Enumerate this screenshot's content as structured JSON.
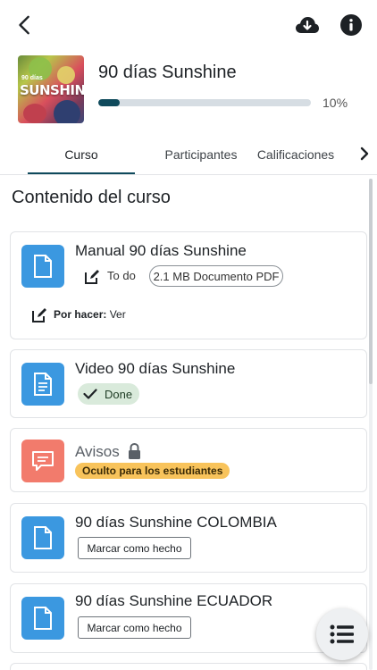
{
  "course": {
    "title": "90 días Sunshine",
    "progress_percent": 10,
    "progress_label": "10%",
    "thumbnail": {
      "line1": "90 días",
      "line2": "SUNSHINE"
    }
  },
  "topbar": {
    "back_icon": "arrow-left-icon",
    "download_icon": "cloud-download-icon",
    "info_icon": "info-icon"
  },
  "tabs": [
    {
      "label": "Curso",
      "active": true
    },
    {
      "label": "Participantes",
      "active": false
    },
    {
      "label": "Calificaciones",
      "active": false
    }
  ],
  "section_title": "Contenido del curso",
  "modules": [
    {
      "title": "Manual 90 días Sunshine",
      "icon": "document-icon",
      "todo_label": "To do",
      "file_info": "2.1 MB Documento PDF",
      "todo_prefix": "Por hacer:",
      "todo_action": "Ver"
    },
    {
      "title": "Video 90 días Sunshine",
      "icon": "document-lines-icon",
      "status": "Done"
    },
    {
      "title": "Avisos",
      "icon": "forum-icon",
      "hidden_label": "Oculto para los estudiantes"
    },
    {
      "title": "90 días Sunshine COLOMBIA",
      "icon": "document-icon",
      "button": "Marcar como hecho"
    },
    {
      "title": "90 días Sunshine ECUADOR",
      "icon": "document-icon",
      "button": "Marcar como hecho"
    }
  ],
  "colors": {
    "accent": "#0f4a5c",
    "module_blue": "#3b98e0",
    "module_red": "#f27b6c",
    "done_bg": "#d9eadb",
    "hidden_bg": "#f8c35b"
  }
}
